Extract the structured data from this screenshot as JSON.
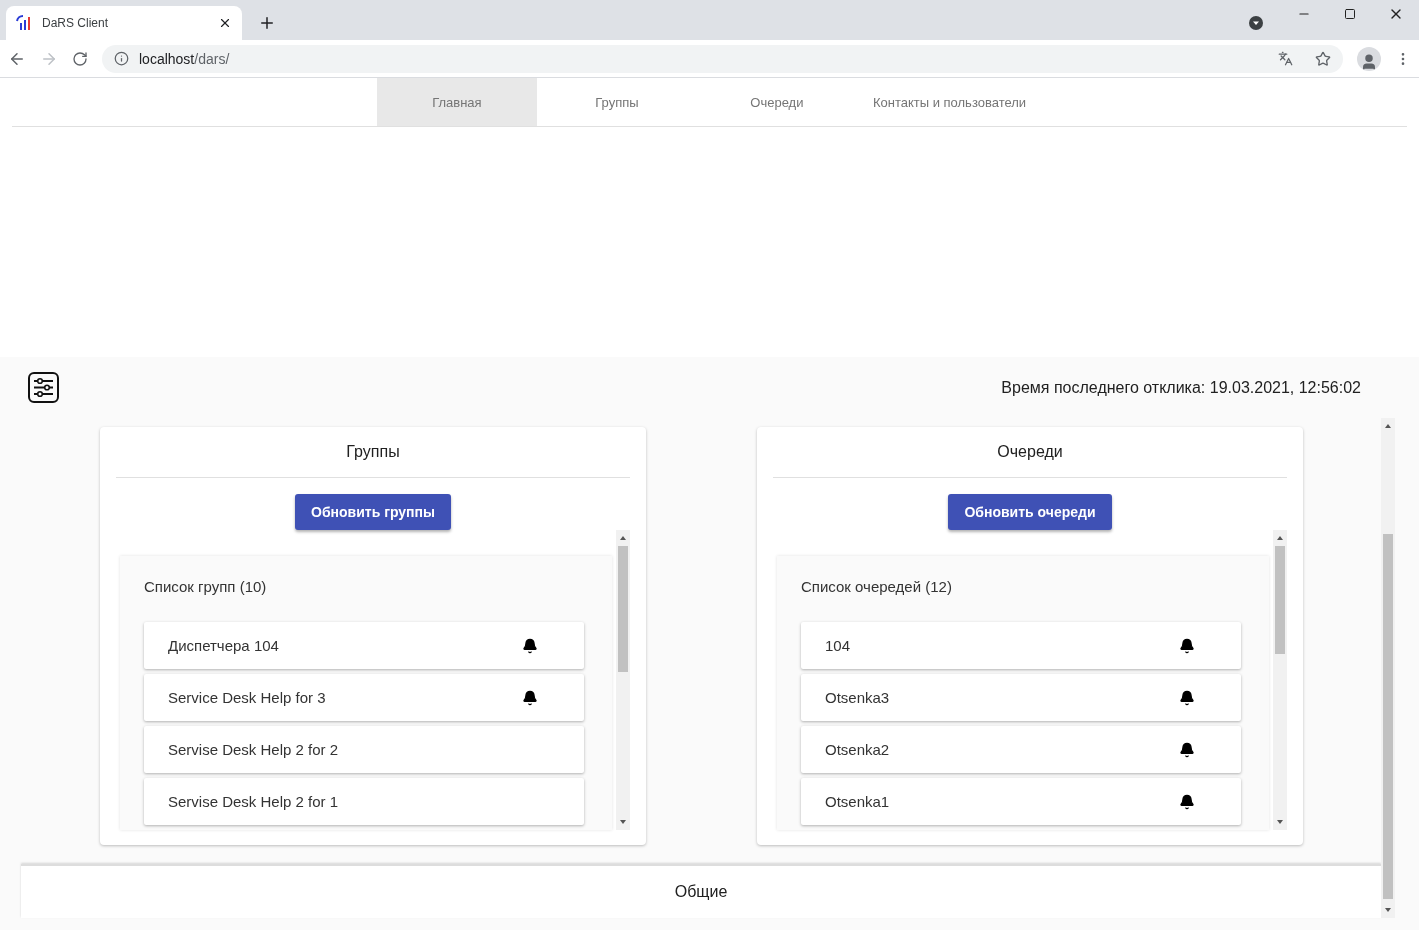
{
  "browser": {
    "tab_title": "DaRS Client",
    "url_host": "localhost",
    "url_path": "/dars/"
  },
  "nav": [
    {
      "label": "Главная",
      "selected": true
    },
    {
      "label": "Группы",
      "selected": false
    },
    {
      "label": "Очереди",
      "selected": false
    },
    {
      "label": "Контакты и пользователи",
      "selected": false
    }
  ],
  "last_response": "Время последнего отклика: 19.03.2021, 12:56:02",
  "panels": [
    {
      "title": "Группы",
      "button": "Обновить группы",
      "list_title": "Список групп (10)",
      "items": [
        {
          "name": "Диспетчера 104",
          "notify": true
        },
        {
          "name": "Service Desk Help for 3",
          "notify": true
        },
        {
          "name": "Servise Desk Help 2 for 2",
          "notify": false
        },
        {
          "name": "Servise Desk Help 2 for 1",
          "notify": false
        }
      ]
    },
    {
      "title": "Очереди",
      "button": "Обновить очереди",
      "list_title": "Список очередей (12)",
      "items": [
        {
          "name": "104",
          "notify": true
        },
        {
          "name": "Otsenka3",
          "notify": true
        },
        {
          "name": "Otsenka2",
          "notify": true
        },
        {
          "name": "Otsenka1",
          "notify": true
        }
      ]
    }
  ],
  "footer_section": "Общие"
}
